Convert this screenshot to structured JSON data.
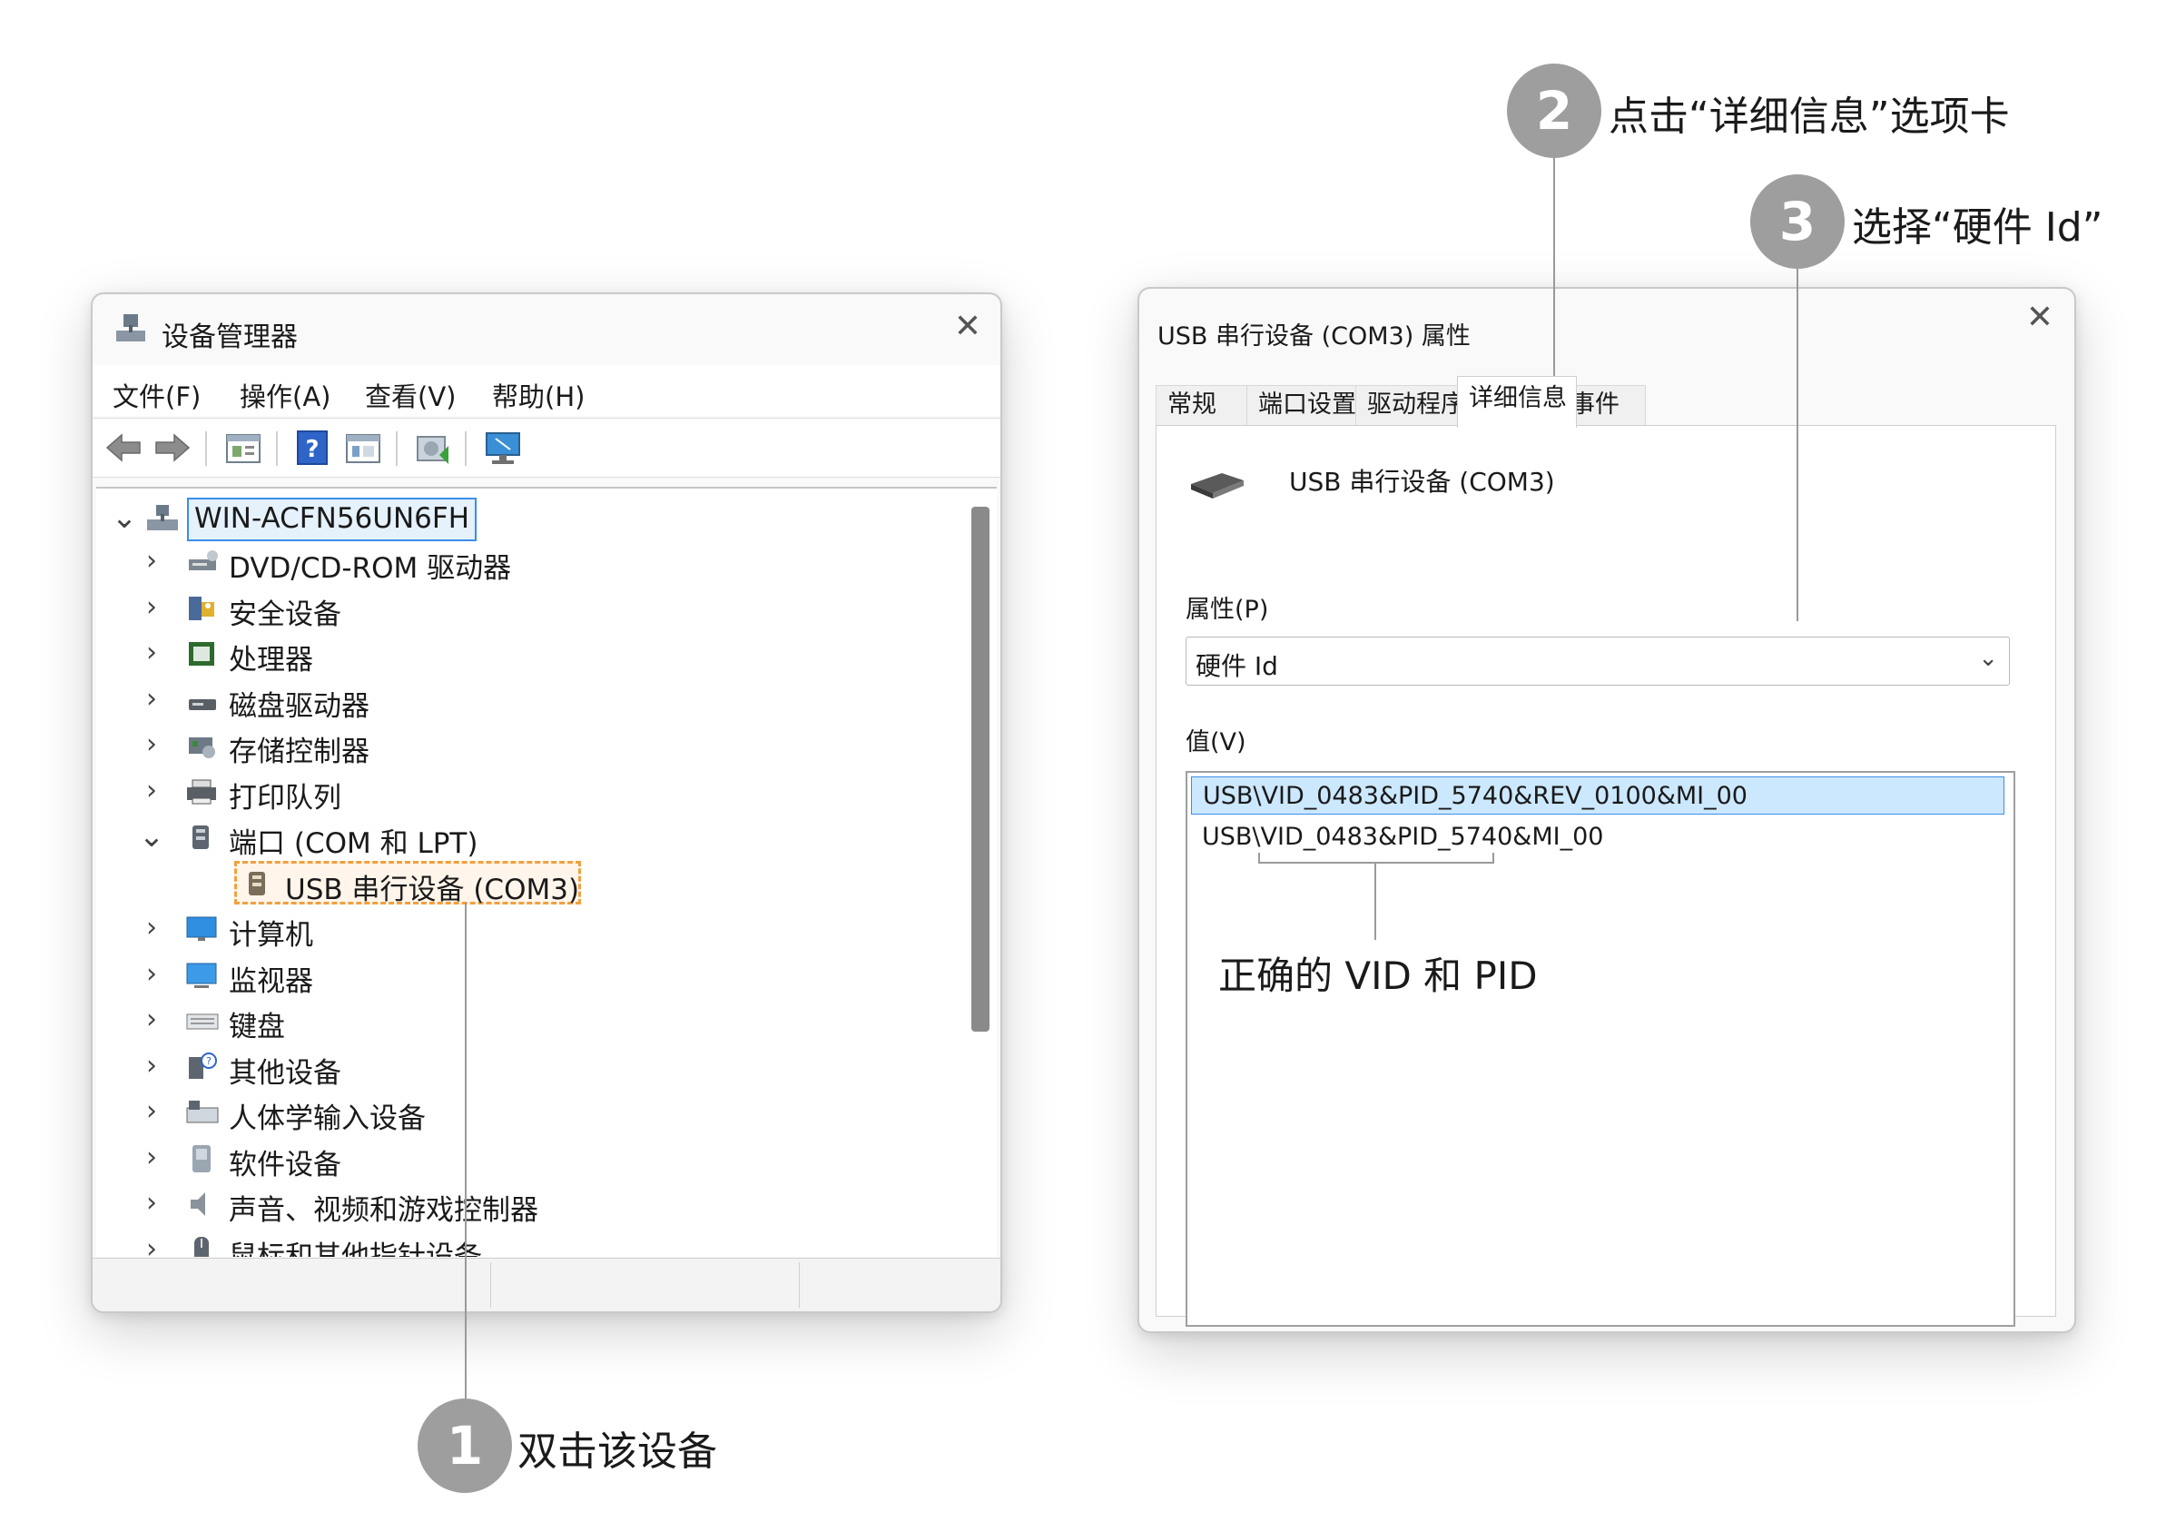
{
  "device_manager": {
    "title": "设备管理器",
    "menu": [
      "文件(F)",
      "操作(A)",
      "查看(V)",
      "帮助(H)"
    ],
    "toolbar_icons": [
      "back-arrow-icon",
      "forward-arrow-icon",
      "properties-icon",
      "help-icon",
      "view-icon",
      "update-driver-icon",
      "scan-monitor-icon"
    ],
    "computer_name": "WIN-ACFN56UN6FH",
    "tree": [
      {
        "label": "DVD/CD-ROM 驱动器",
        "icon": "dvd-drive-icon",
        "expanded": false
      },
      {
        "label": "安全设备",
        "icon": "security-device-icon",
        "expanded": false
      },
      {
        "label": "处理器",
        "icon": "processor-icon",
        "expanded": false
      },
      {
        "label": "磁盘驱动器",
        "icon": "disk-drive-icon",
        "expanded": false
      },
      {
        "label": "存储控制器",
        "icon": "storage-controller-icon",
        "expanded": false
      },
      {
        "label": "打印队列",
        "icon": "printer-icon",
        "expanded": false
      },
      {
        "label": "端口 (COM 和 LPT)",
        "icon": "port-icon",
        "expanded": true
      },
      {
        "label": "USB 串行设备 (COM3)",
        "icon": "usb-serial-icon",
        "child": true,
        "highlighted": true
      },
      {
        "label": "计算机",
        "icon": "computer-icon",
        "expanded": false
      },
      {
        "label": "监视器",
        "icon": "monitor-icon",
        "expanded": false
      },
      {
        "label": "键盘",
        "icon": "keyboard-icon",
        "expanded": false
      },
      {
        "label": "其他设备",
        "icon": "other-device-icon",
        "expanded": false
      },
      {
        "label": "人体学输入设备",
        "icon": "hid-icon",
        "expanded": false
      },
      {
        "label": "软件设备",
        "icon": "software-device-icon",
        "expanded": false
      },
      {
        "label": "声音、视频和游戏控制器",
        "icon": "sound-icon",
        "expanded": false
      },
      {
        "label": "鼠标和其他指针设备",
        "icon": "mouse-icon",
        "expanded": false
      }
    ]
  },
  "properties": {
    "title": "USB 串行设备 (COM3) 属性",
    "tabs": [
      "常规",
      "端口设置",
      "驱动程序",
      "详细信息",
      "事件"
    ],
    "active_tab": "详细信息",
    "device_name": "USB 串行设备 (COM3)",
    "property_label": "属性(P)",
    "property_value": "硬件 Id",
    "value_label": "值(V)",
    "values": [
      "USB\\VID_0483&PID_5740&REV_0100&MI_00",
      "USB\\VID_0483&PID_5740&MI_00"
    ]
  },
  "annotations": {
    "step1": {
      "number": "1",
      "text": "双击该设备"
    },
    "step2": {
      "number": "2",
      "text": "点击“详细信息”选项卡"
    },
    "step3": {
      "number": "3",
      "text": "选择“硬件 Id”"
    },
    "vid_pid_note": "正确的 VID 和 PID"
  },
  "colors": {
    "highlight_orange": "#f0a040",
    "selection_blue": "#cce8ff",
    "selection_border": "#3b8ee8",
    "badge_gray": "#9e9e9e"
  }
}
